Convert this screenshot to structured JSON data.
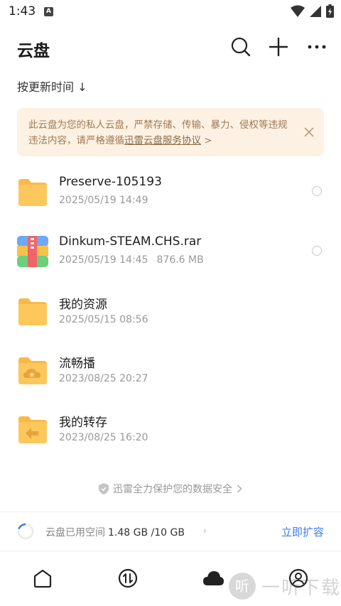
{
  "status_bar": {
    "time": "1:43",
    "notif_letter": "A"
  },
  "header": {
    "title": "云盘"
  },
  "sort": {
    "label": "按更新时间 ↓"
  },
  "notice": {
    "text_before": "此云盘为您的私人云盘，严禁存储、传输、暴力、侵权等违规违法内容，请严格遵循",
    "link": "迅雷云盘服务协议",
    "text_after": " >"
  },
  "files": [
    {
      "name": "Preserve-105193",
      "date": "2025/05/19 14:49",
      "size": "",
      "icon": "folder-icon"
    },
    {
      "name": "Dinkum-STEAM.CHS.rar",
      "date": "2025/05/19 14:45",
      "size": "876.6 MB",
      "icon": "archive-icon"
    },
    {
      "name": "我的资源",
      "date": "2025/05/15 08:56",
      "size": "",
      "icon": "folder-icon"
    },
    {
      "name": "流畅播",
      "date": "2023/08/25 20:27",
      "size": "",
      "icon": "cloud-folder-icon"
    },
    {
      "name": "我的转存",
      "date": "2023/08/25 16:20",
      "size": "",
      "icon": "transfer-folder-icon"
    }
  ],
  "secure": {
    "text": "迅雷全力保护您的数据安全"
  },
  "storage": {
    "label": "云盘已用空间",
    "value": "1.48 GB /10 GB",
    "action": "立即扩容"
  },
  "watermark": {
    "glyph": "听",
    "text": "一听下载"
  },
  "colors": {
    "accent": "#3a7bf5",
    "folder": "#fcc75b",
    "notice_bg": "#fdf1e3"
  }
}
